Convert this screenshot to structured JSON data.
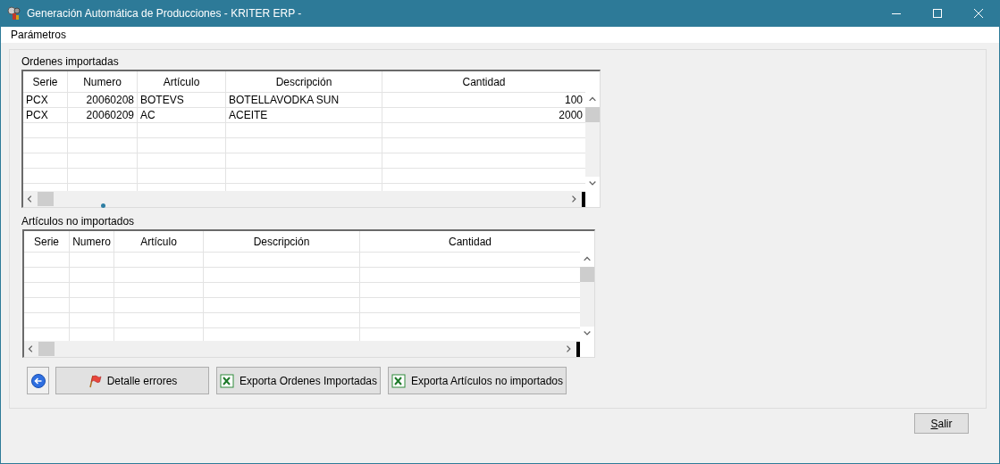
{
  "window": {
    "title": "Generación Automática de Producciones - KRITER ERP -"
  },
  "menu": [
    {
      "label": "Parámetros"
    }
  ],
  "imported_orders": {
    "title": "Ordenes importadas",
    "columns": [
      {
        "label": "Serie"
      },
      {
        "label": "Numero"
      },
      {
        "label": "Artículo"
      },
      {
        "label": "Descripción"
      },
      {
        "label": "Cantidad"
      }
    ],
    "rows": [
      [
        "PCX",
        "20060208",
        "BOTEVS",
        "BOTELLAVODKA SUN",
        "100"
      ],
      [
        "PCX",
        "20060209",
        "AC",
        "ACEITE",
        "2000"
      ]
    ]
  },
  "not_imported_articles": {
    "title": "Artículos no importados",
    "columns": [
      {
        "label": "Serie"
      },
      {
        "label": "Numero"
      },
      {
        "label": "Artículo"
      },
      {
        "label": "Descripción"
      },
      {
        "label": "Cantidad"
      }
    ]
  },
  "actions": [
    {
      "kind": "back"
    },
    {
      "kind": "flag",
      "label": "Detalle errores"
    },
    {
      "kind": "excel",
      "label": "Exporta Ordenes Importadas"
    },
    {
      "kind": "excel",
      "label": "Exporta Artículos no importados"
    }
  ],
  "exit_button": {
    "label": "Salir"
  }
}
